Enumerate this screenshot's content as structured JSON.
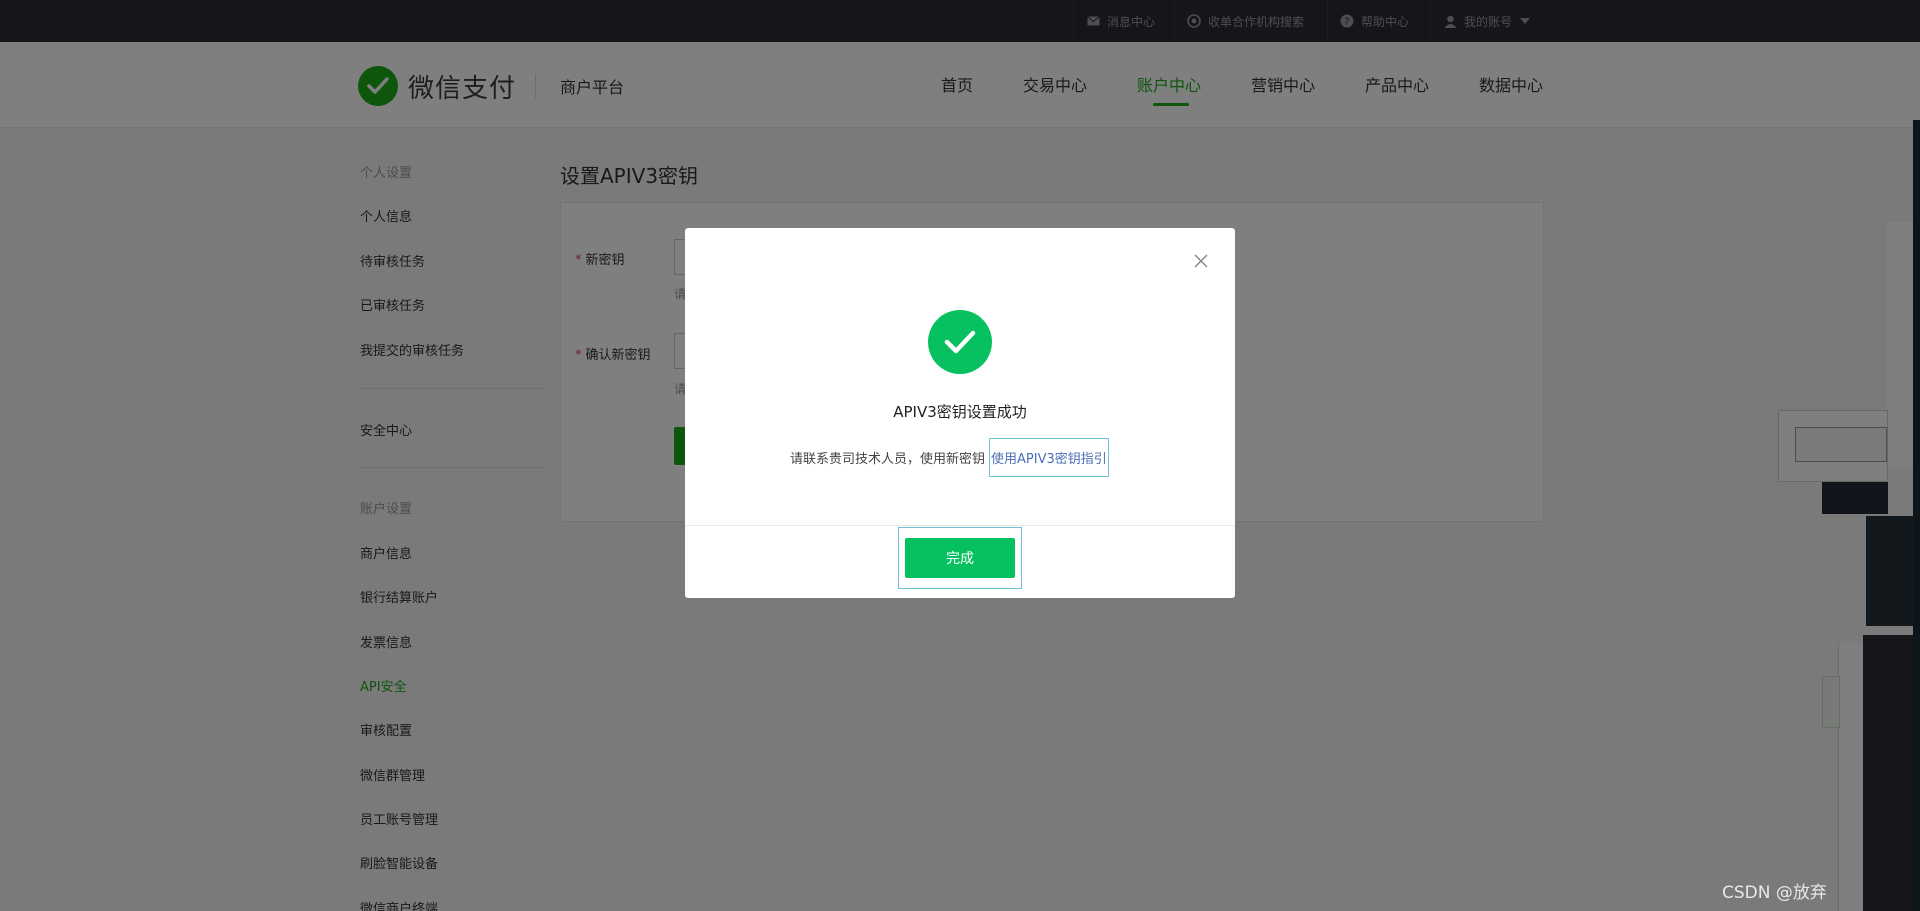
{
  "topbar": {
    "items": [
      {
        "label": "消息中心",
        "icon": "mail-icon"
      },
      {
        "label": "收单合作机构搜索",
        "icon": "search-circle-icon"
      },
      {
        "label": "帮助中心",
        "icon": "help-icon"
      },
      {
        "label": "我的账号",
        "icon": "user-icon"
      }
    ]
  },
  "header": {
    "brand": "微信支付",
    "platform": "商户平台",
    "nav": [
      "首页",
      "交易中心",
      "账户中心",
      "营销中心",
      "产品中心",
      "数据中心"
    ],
    "active_nav": "账户中心"
  },
  "sidebar": {
    "group1": "个人设置",
    "group1_items": [
      "个人信息",
      "待审核任务",
      "已审核任务",
      "我提交的审核任务"
    ],
    "security": "安全中心",
    "group2": "账户设置",
    "group2_items": [
      "商户信息",
      "银行结算账户",
      "发票信息",
      "API安全",
      "审核配置",
      "微信群管理",
      "员工账号管理",
      "刷脸智能设备",
      "微信商户终端"
    ],
    "active_item": "API安全"
  },
  "main": {
    "title": "设置APIV3密钥",
    "field1_label": "新密钥",
    "field2_label": "确认新密钥",
    "hint": "请"
  },
  "modal": {
    "title": "APIV3密钥设置成功",
    "desc": "请联系贵司技术人员，使用新密钥",
    "link": "使用APIV3密钥指引",
    "done": "完成"
  },
  "watermark": "CSDN @放弃",
  "colors": {
    "brand_green": "#1aad19",
    "success_green": "#07c160",
    "link_blue": "#4a6fb5",
    "topbar_bg": "#2a2c33"
  }
}
